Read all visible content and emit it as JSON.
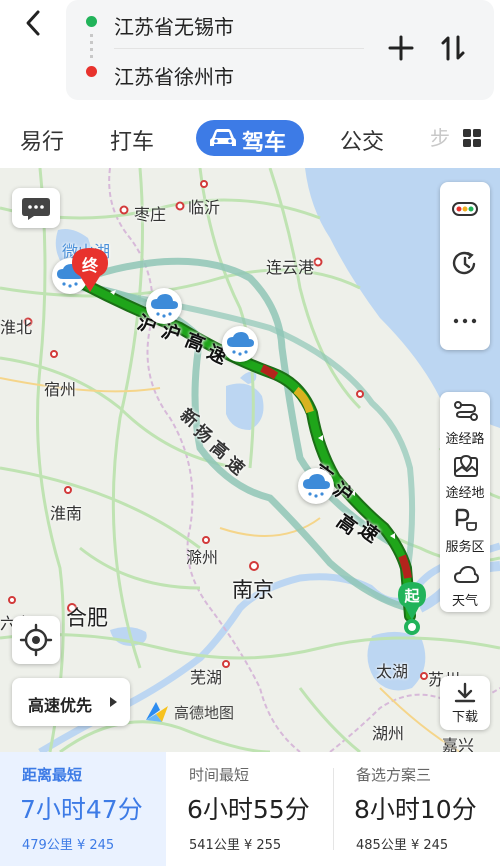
{
  "header": {
    "from": "江苏省无锡市",
    "to": "江苏省徐州市",
    "icons": [
      "back-icon",
      "plus-icon",
      "swap-icon"
    ]
  },
  "tabs": [
    {
      "label": "易行"
    },
    {
      "label": "打车"
    },
    {
      "label": "驾车",
      "selected": true
    },
    {
      "label": "公交"
    },
    {
      "label": "步"
    }
  ],
  "map": {
    "cities": {
      "zaozhuang": "枣庄",
      "linyi": "临沂",
      "lianyungang": "连云港",
      "weishanhu": "微山湖",
      "huaibei": "淮北",
      "suzhou_ah": "宿州",
      "huainan": "淮南",
      "chuzhou": "滁州",
      "nanjing": "南京",
      "hefei": "合肥",
      "wuhu": "芜湖",
      "taihu": "太湖",
      "suzhou_js": "苏州",
      "huzhou": "湖州",
      "jiaxing": "嘉兴",
      "liuan": "六安"
    },
    "roads": {
      "r1a": "沪",
      "r1b": "高",
      "r1c": "速",
      "r2a": "新",
      "r2b": "扬",
      "r2c": "高",
      "r2d": "速",
      "r3a": "京",
      "r3b": "沪",
      "r3c": "高",
      "r3d": "速"
    },
    "pins": {
      "end": "终",
      "start": "起"
    },
    "brand": "高德地图",
    "route_preference": "高速优先"
  },
  "side_tools": [
    {
      "label": "途经路",
      "icon": "via-road-icon"
    },
    {
      "label": "途经地",
      "icon": "via-place-icon"
    },
    {
      "label": "服务区",
      "icon": "service-area-icon"
    },
    {
      "label": "天气",
      "icon": "weather-icon"
    }
  ],
  "download": {
    "label": "下载"
  },
  "routes": [
    {
      "label": "距离最短",
      "time": "7小时47分",
      "distance": "479公里",
      "toll": "¥ 245",
      "selected": true
    },
    {
      "label": "时间最短",
      "time": "6小时55分",
      "distance": "541公里",
      "toll": "¥ 255"
    },
    {
      "label": "备选方案三",
      "time": "8小时10分",
      "distance": "485公里",
      "toll": "¥ 245"
    }
  ],
  "colors": {
    "accent": "#3d7be6",
    "route_green": "#1fa51a",
    "start_green": "#21b35a",
    "end_red": "#e8322d"
  }
}
